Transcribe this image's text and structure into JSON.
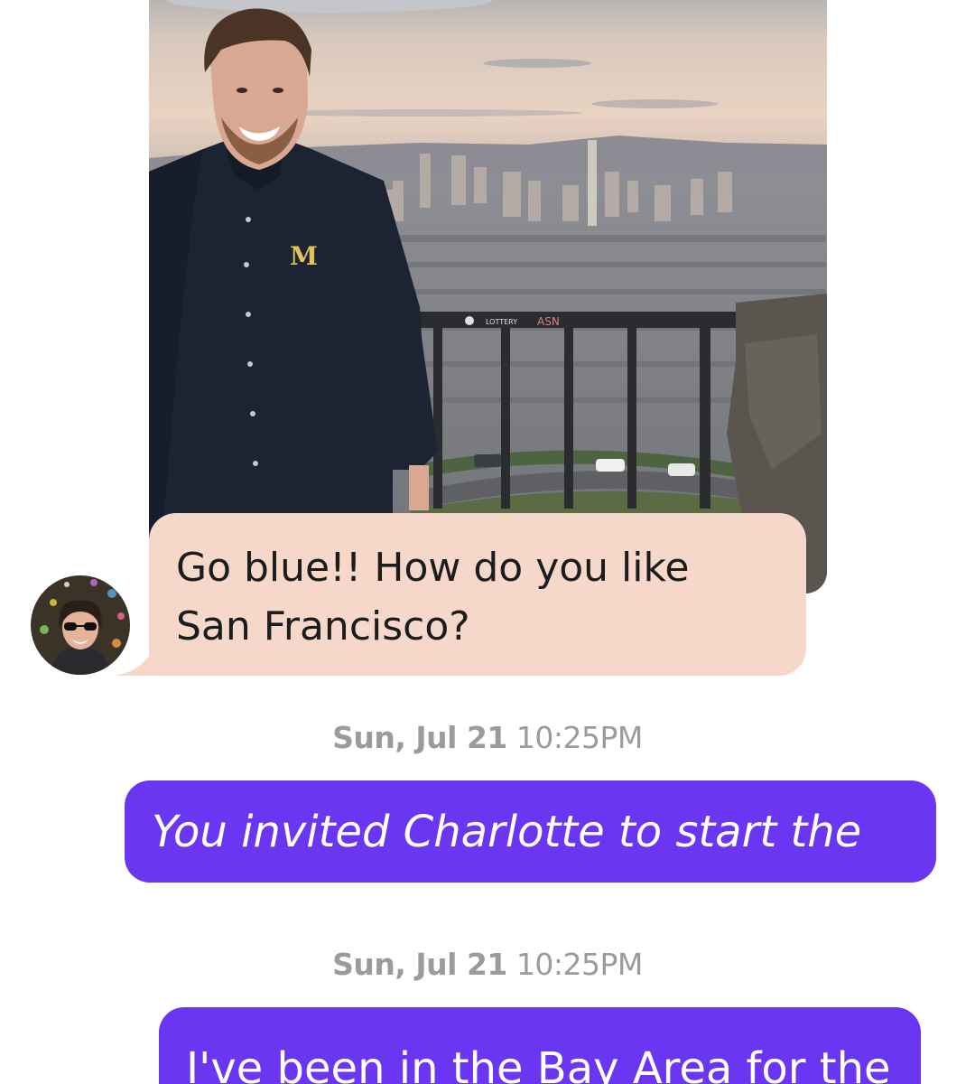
{
  "conversation": {
    "photo": {
      "icon": "photo-of-man-overlooking-city"
    },
    "received_message": {
      "text": "Go blue!! How do you like\nSan Francisco?",
      "bubble_color": "#f5d8ca"
    },
    "avatar": {
      "icon": "avatar-woman-sunglasses"
    },
    "timestamps": [
      {
        "date": "Sun, Jul 21",
        "time": "10:25PM"
      },
      {
        "date": "Sun, Jul 21",
        "time": "10:25PM"
      }
    ],
    "sent_messages": [
      {
        "text": "You invited Charlotte to start the"
      },
      {
        "text": "I've been in the Bay Area for the"
      }
    ],
    "sent_bubble_color": "#6a36f2",
    "timestamp_color": "#9b9b9b"
  }
}
